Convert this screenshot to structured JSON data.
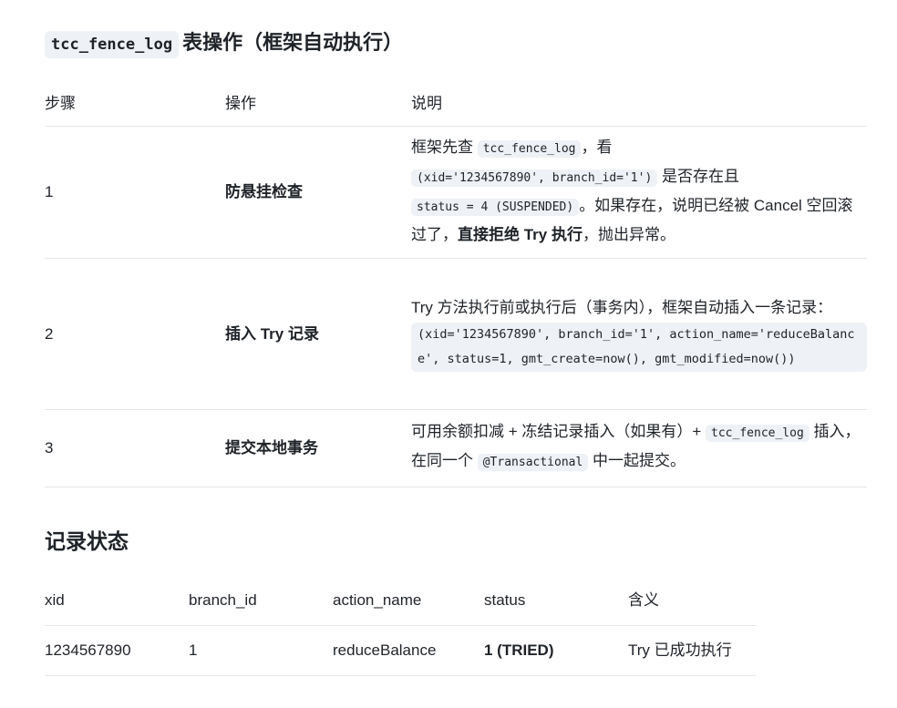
{
  "section_heading": {
    "code": "tcc_fence_log",
    "text": "表操作（框架自动执行）"
  },
  "ops_table": {
    "headers": [
      "步骤",
      "操作",
      "说明"
    ],
    "rows": [
      {
        "step": "1",
        "op": "防悬挂检查",
        "desc": {
          "p1": "框架先查 ",
          "c1": "tcc_fence_log",
          "p2": "，看",
          "c2": "(xid='1234567890', branch_id='1')",
          "p3": " 是否存在且",
          "c3": "status = 4 (SUSPENDED)",
          "p4": "。如果存在，说明已经被 Cancel 空回滚过了，",
          "b1": "直接拒绝 Try 执行",
          "p5": "，抛出异常。"
        }
      },
      {
        "step": "2",
        "op": "插入 Try 记录",
        "desc": {
          "p1": "Try 方法执行前或执行后（事务内），框架自动插入一条记录：",
          "code": "(xid='1234567890', branch_id='1', action_name='reduceBalance', status=1, gmt_create=now(), gmt_modified=now())"
        }
      },
      {
        "step": "3",
        "op": "提交本地事务",
        "desc": {
          "p1": "可用余额扣减 + 冻结记录插入（如果有）+ ",
          "c1": "tcc_fence_log",
          "p2": " 插入，在同一个 ",
          "c2": "@Transactional",
          "p3": " 中一起提交。"
        }
      }
    ]
  },
  "status_heading": "记录状态",
  "status_table": {
    "headers": [
      "xid",
      "branch_id",
      "action_name",
      "status",
      "含义"
    ],
    "row": {
      "xid": "1234567890",
      "branch_id": "1",
      "action_name": "reduceBalance",
      "status": "1 (TRIED)",
      "meaning": "Try 已成功执行"
    }
  }
}
